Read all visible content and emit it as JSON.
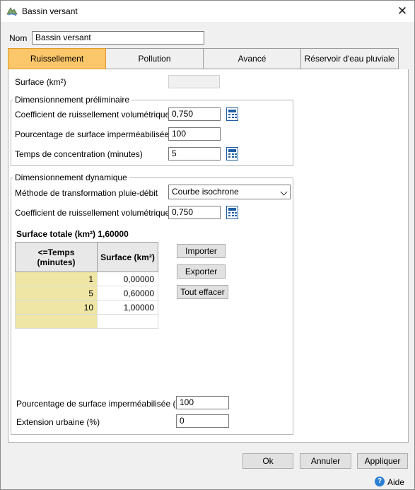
{
  "window": {
    "title": "Bassin versant",
    "close_symbol": "✕"
  },
  "nom": {
    "label": "Nom",
    "value": "Bassin versant"
  },
  "tabs": [
    {
      "label": "Ruissellement",
      "active": true
    },
    {
      "label": "Pollution",
      "active": false
    },
    {
      "label": "Avancé",
      "active": false
    },
    {
      "label": "Réservoir d'eau pluviale",
      "active": false
    }
  ],
  "surface": {
    "label": "Surface (km²)",
    "value": ""
  },
  "prelim": {
    "legend": "Dimensionnement préliminaire",
    "coef_label": "Coefficient de ruissellement volumétrique",
    "coef_value": "0,750",
    "pct_label": "Pourcentage de surface imperméabilisée (%)",
    "pct_value": "100",
    "temps_label": "Temps de concentration (minutes)",
    "temps_value": "5"
  },
  "dynamic": {
    "legend": "Dimensionnement dynamique",
    "method_label": "Méthode de transformation pluie-débit",
    "method_value": "Courbe isochrone",
    "coef_label": "Coefficient de ruissellement volumétrique",
    "coef_value": "0,750",
    "total_label": "Surface totale (km²) 1,60000",
    "table": {
      "col1": "<=Temps (minutes)",
      "col2": "Surface (km²)",
      "rows": [
        {
          "t": "1",
          "s": "0,00000"
        },
        {
          "t": "5",
          "s": "0,60000"
        },
        {
          "t": "10",
          "s": "1,00000"
        },
        {
          "t": "",
          "s": ""
        }
      ]
    },
    "buttons": {
      "import": "Importer",
      "export": "Exporter",
      "clear": "Tout effacer"
    },
    "pct_label": "Pourcentage de surface imperméabilisée (%)",
    "pct_value": "100",
    "ext_label": "Extension urbaine (%)",
    "ext_value": "0"
  },
  "footer": {
    "ok": "Ok",
    "cancel": "Annuler",
    "apply": "Appliquer",
    "help": "Aide",
    "help_icon_glyph": "?"
  }
}
